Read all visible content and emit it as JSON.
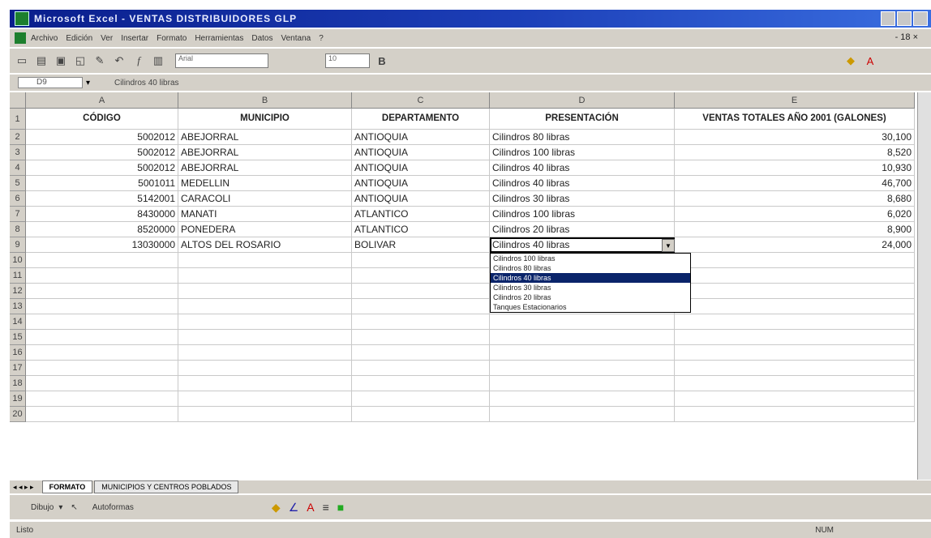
{
  "window": {
    "title": "Microsoft Excel - VENTAS DISTRIBUIDORES GLP"
  },
  "menu": {
    "items": [
      "Archivo",
      "Edición",
      "Ver",
      "Insertar",
      "Formato",
      "Herramientas",
      "Datos",
      "Ventana",
      "?"
    ],
    "doc_index": "- 18 ×"
  },
  "toolbar": {
    "font": "Arial",
    "size": "10"
  },
  "formula_bar": {
    "cell_ref": "D9",
    "value": "Cilindros 40 libras"
  },
  "columns": [
    "A",
    "B",
    "C",
    "D",
    "E"
  ],
  "headers": {
    "codigo": "CÓDIGO",
    "municipio": "MUNICIPIO",
    "departamento": "DEPARTAMENTO",
    "presentacion": "PRESENTACIÓN",
    "ventas": "VENTAS TOTALES AÑO 2001 (GALONES)"
  },
  "rows": [
    {
      "codigo": "5002012",
      "municipio": "ABEJORRAL",
      "departamento": "ANTIOQUIA",
      "presentacion": "Cilindros 80 libras",
      "ventas": "30,100"
    },
    {
      "codigo": "5002012",
      "municipio": "ABEJORRAL",
      "departamento": "ANTIOQUIA",
      "presentacion": "Cilindros 100 libras",
      "ventas": "8,520"
    },
    {
      "codigo": "5002012",
      "municipio": "ABEJORRAL",
      "departamento": "ANTIOQUIA",
      "presentacion": "Cilindros 40 libras",
      "ventas": "10,930"
    },
    {
      "codigo": "5001011",
      "municipio": "MEDELLIN",
      "departamento": "ANTIOQUIA",
      "presentacion": "Cilindros 40 libras",
      "ventas": "46,700"
    },
    {
      "codigo": "5142001",
      "municipio": "CARACOLI",
      "departamento": "ANTIOQUIA",
      "presentacion": "Cilindros 30 libras",
      "ventas": "8,680"
    },
    {
      "codigo": "8430000",
      "municipio": "MANATI",
      "departamento": "ATLANTICO",
      "presentacion": "Cilindros 100 libras",
      "ventas": "6,020"
    },
    {
      "codigo": "8520000",
      "municipio": "PONEDERA",
      "departamento": "ATLANTICO",
      "presentacion": "Cilindros 20 libras",
      "ventas": "8,900"
    },
    {
      "codigo": "13030000",
      "municipio": "ALTOS DEL ROSARIO",
      "departamento": "BOLIVAR",
      "presentacion": "Cilindros 40 libras",
      "ventas": "24,000"
    }
  ],
  "row_numbers": [
    "1",
    "2",
    "3",
    "4",
    "5",
    "6",
    "7",
    "8",
    "9",
    "10",
    "11",
    "12",
    "13",
    "14",
    "15",
    "16",
    "17",
    "18",
    "19",
    "20"
  ],
  "dropdown": {
    "options": [
      "Cilindros 100 libras",
      "Cilindros 80 libras",
      "Cilindros 40 libras",
      "Cilindros 30 libras",
      "Cilindros 20 libras",
      "Tanques Estacionarios"
    ],
    "selected": 2
  },
  "sheet_tabs": [
    "FORMATO",
    "MUNICIPIOS Y CENTROS POBLADOS"
  ],
  "drawing": {
    "dibujo": "Dibujo",
    "autoformas": "Autoformas"
  },
  "status": {
    "left": "Listo",
    "num": "NUM"
  }
}
